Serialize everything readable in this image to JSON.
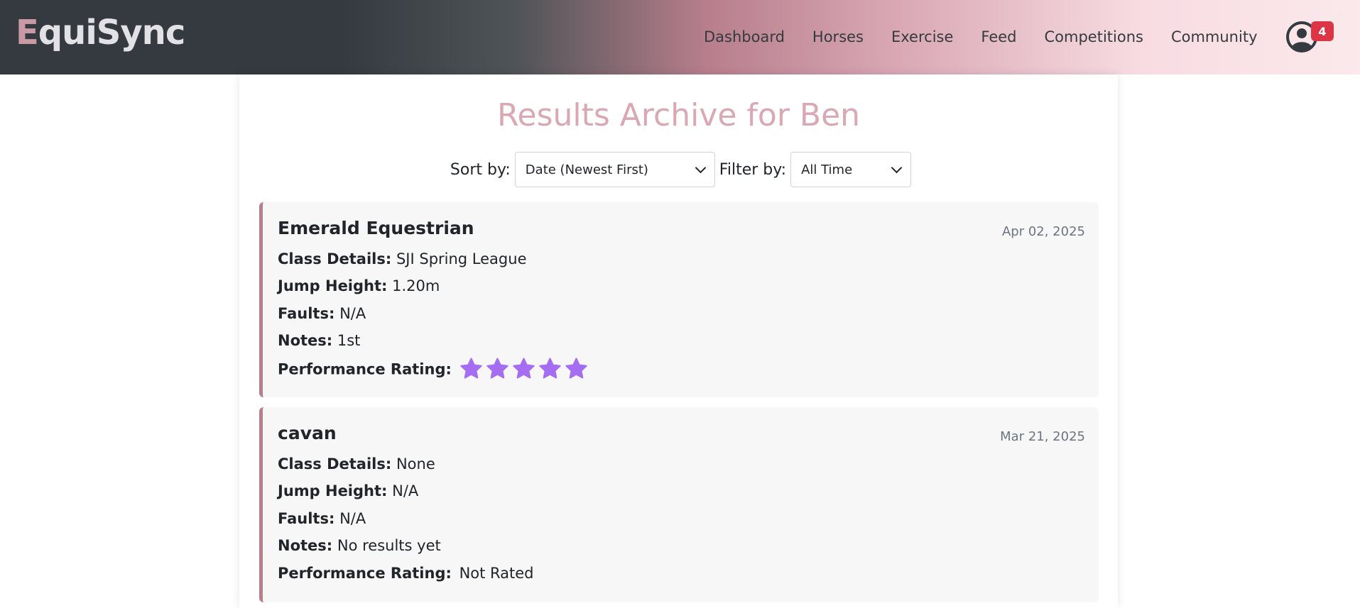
{
  "brand": {
    "first": "E",
    "rest": "quiSync"
  },
  "nav": {
    "links": [
      "Dashboard",
      "Horses",
      "Exercise",
      "Feed",
      "Competitions",
      "Community"
    ],
    "notifications": "4"
  },
  "page": {
    "title": "Results Archive for Ben",
    "sort_label": "Sort by:",
    "sort_value": "Date (Newest First)",
    "filter_label": "Filter by:",
    "filter_value": "All Time"
  },
  "field_labels": {
    "class_details": "Class Details:",
    "jump_height": "Jump Height:",
    "faults": "Faults:",
    "notes": "Notes:",
    "performance_rating": "Performance Rating:"
  },
  "results": [
    {
      "name": "Emerald Equestrian",
      "date": "Apr 02, 2025",
      "class_details": "SJI Spring League",
      "jump_height": "1.20m",
      "faults": "N/A",
      "notes": "1st",
      "rating_stars": 5,
      "rating_text": ""
    },
    {
      "name": "cavan",
      "date": "Mar 21, 2025",
      "class_details": "None",
      "jump_height": "N/A",
      "faults": "N/A",
      "notes": "No results yet",
      "rating_stars": 0,
      "rating_text": "Not Rated"
    }
  ],
  "colors": {
    "accent": "#b87e8c",
    "title": "#d9a8b4",
    "star": "#a56ef2",
    "badge": "#dc3545"
  },
  "icons": {
    "avatar": "user-circle-icon",
    "star": "star-icon",
    "caret": "caret-down-icon"
  }
}
